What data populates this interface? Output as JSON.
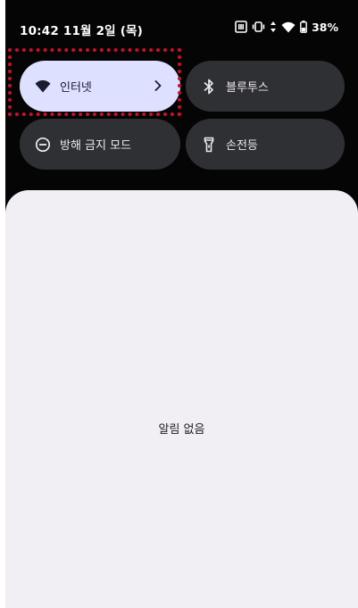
{
  "status_bar": {
    "time_date": "10:42 11월 2일 (목)",
    "battery_percent": "38%",
    "icons": [
      "nfc-icon",
      "vibrate-icon",
      "data-arrows-icon",
      "wifi-icon",
      "battery-icon"
    ]
  },
  "tiles": [
    {
      "id": "internet",
      "label": "인터넷",
      "icon": "wifi-icon",
      "active": true,
      "has_chevron": true
    },
    {
      "id": "bluetooth",
      "label": "블루투스",
      "icon": "bluetooth-icon",
      "active": false
    },
    {
      "id": "dnd",
      "label": "방해 금지 모드",
      "icon": "do-not-disturb-icon",
      "active": false
    },
    {
      "id": "flashlight",
      "label": "손전등",
      "icon": "flashlight-icon",
      "active": false
    }
  ],
  "notifications": {
    "empty_text": "알림 없음"
  },
  "colors": {
    "shade_background": "#050505",
    "tile_inactive": "#2f3033",
    "tile_active": "#dde0ff",
    "panel_background": "#f1eff4",
    "focus_outline": "#c8102e"
  }
}
